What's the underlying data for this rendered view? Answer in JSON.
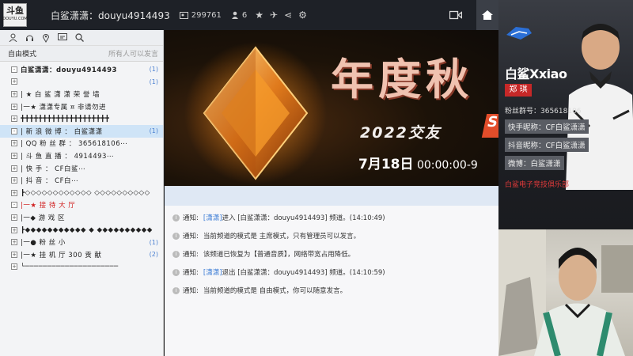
{
  "topbar": {
    "logo_main": "斗鱼",
    "logo_small": "DOUYU.COM",
    "title": "白鲨潇潇：douyu4914493",
    "viewer_count": "299761",
    "user_count": "6"
  },
  "left_panel": {
    "mode_label": "自由模式",
    "mode_right": "所有人可以发言",
    "channels": [
      {
        "name": "白鲨潇潇：douyu4914493",
        "count": "(1)",
        "selected": false,
        "red": false,
        "bold": true,
        "icon": "-"
      },
      {
        "name": "",
        "count": "(1)",
        "selected": false,
        "red": false,
        "icon": "+"
      },
      {
        "name": "|      ★  白 鲨 潇 潇 荣 誉 墙",
        "count": "",
        "selected": false,
        "red": false,
        "icon": "+"
      },
      {
        "name": "|一★    潇潇专属 ¤ 非请勿进",
        "count": "",
        "selected": false,
        "red": false,
        "icon": "+"
      },
      {
        "name": "╋╋╋╋╋╋╋╋╋╋╋╋╋╋╋╋╋╋╋╋",
        "count": "",
        "selected": false,
        "red": false,
        "icon": "+"
      },
      {
        "name": "| 新 浪 微 博 ：      白鲨潇潇",
        "count": "(1)",
        "selected": true,
        "red": false,
        "icon": "-"
      },
      {
        "name": "|        QQ 粉 丝 群 ：   365618106⋯",
        "count": "",
        "selected": false,
        "red": false,
        "icon": "+"
      },
      {
        "name": "|          斗 鱼 直 播 ：        4914493⋯",
        "count": "",
        "selected": false,
        "red": false,
        "icon": "+"
      },
      {
        "name": "|              快     手 ：          CF白鲨⋯",
        "count": "",
        "selected": false,
        "red": false,
        "icon": "+"
      },
      {
        "name": "|              抖     音 ：             CF白⋯",
        "count": "",
        "selected": false,
        "red": false,
        "icon": "+"
      },
      {
        "name": "┣◇◇◇◇◇◇◇◇◇◇◇◇ ◇◇◇◇◇◇◇◇◇◇",
        "count": "",
        "selected": false,
        "red": false,
        "icon": "+"
      },
      {
        "name": "|一★       接     待     大     厅",
        "count": "",
        "selected": false,
        "red": true,
        "icon": "-"
      },
      {
        "name": "|一◆           游     戏     区",
        "count": "",
        "selected": false,
        "red": false,
        "icon": "+"
      },
      {
        "name": "┣◆◆◆◆◆◆◆◆◆◆◆ ◆ ◆◆◆◆◆◆◆◆◆◆",
        "count": "",
        "selected": false,
        "red": false,
        "icon": "+"
      },
      {
        "name": "|一●        粉     丝     小",
        "count": "(1)",
        "selected": false,
        "red": false,
        "icon": "+"
      },
      {
        "name": "|一★   挂  机  厅   300  贡 献",
        "count": "(2)",
        "selected": false,
        "red": false,
        "icon": "+"
      },
      {
        "name": "└─────────────────────",
        "count": "",
        "selected": false,
        "red": false,
        "icon": "+"
      }
    ]
  },
  "banner": {
    "title": "年度秋",
    "subtitle": "2022交友",
    "subtitle_end": "S",
    "date": "7月18日",
    "time": " 00:00:00-9"
  },
  "messages": [
    {
      "prefix": "通知:",
      "parts": [
        {
          "t": "[潇潇]",
          "blue": true
        },
        {
          "t": " 进入 [白鲨潇潇：douyu4914493] 频道。(14:10:49)",
          "blue": false
        }
      ]
    },
    {
      "prefix": "通知:",
      "parts": [
        {
          "t": "当前频道的模式是 主席模式，只有管理员可以发言。",
          "blue": false
        }
      ]
    },
    {
      "prefix": "通知:",
      "parts": [
        {
          "t": "该频道已恢复为【普通音质】，网络带宽占用降低。",
          "blue": false
        }
      ]
    },
    {
      "prefix": "通知:",
      "parts": [
        {
          "t": "[潇潇]",
          "blue": true
        },
        {
          "t": " 退出 [白鲨潇潇：douyu4914493] 频道。(14:10:59)",
          "blue": false
        }
      ]
    },
    {
      "prefix": "通知:",
      "parts": [
        {
          "t": "当前频道的模式是 自由模式，你可以随意发言。",
          "blue": false
        }
      ]
    }
  ],
  "card": {
    "name": "白鲨Xxiao",
    "real_name": "郑 琪",
    "fan_group": "粉丝群号：365618106",
    "kuaishou": "快手昵称：CF白鲨潇潇",
    "douyin": "抖音昵称：CF白鲨潇潇",
    "weibo": "微博：白鲨潇潇",
    "club": "白鲨电子竞技俱乐部"
  },
  "colors": {
    "topbar_bg": "#1e2127",
    "accent_blue": "#3a7bd5",
    "accent_red": "#d02020",
    "selected_row": "#cfe4f7"
  }
}
